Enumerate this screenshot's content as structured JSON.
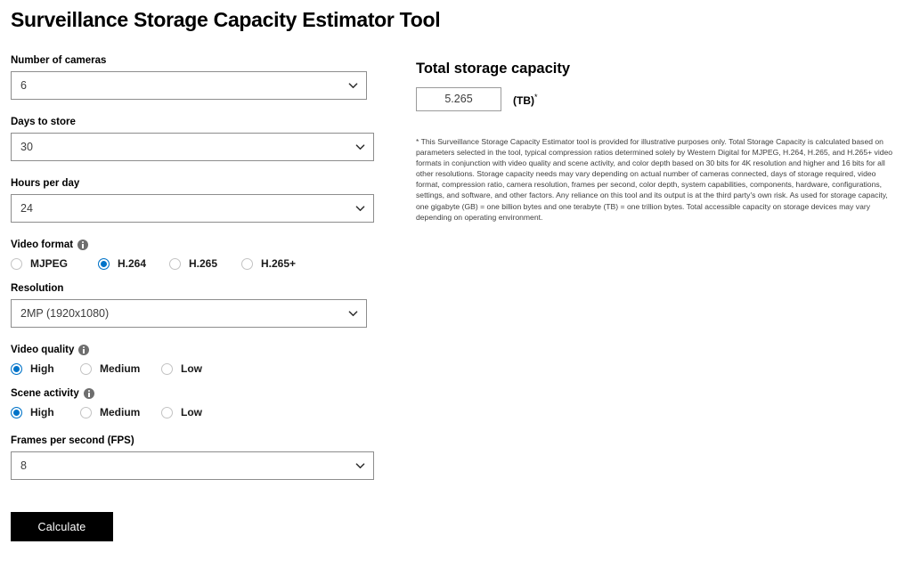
{
  "page": {
    "title": "Surveillance Storage Capacity Estimator Tool"
  },
  "form": {
    "cameras": {
      "label": "Number of cameras",
      "value": "6",
      "icon": "chevron-down-icon"
    },
    "days": {
      "label": "Days to store",
      "value": "30",
      "icon": "chevron-down-icon"
    },
    "hours": {
      "label": "Hours per day",
      "value": "24",
      "icon": "chevron-down-icon"
    },
    "video_format": {
      "label": "Video format",
      "info_icon": "info-icon",
      "options": [
        {
          "label": "MJPEG",
          "selected": false
        },
        {
          "label": "H.264",
          "selected": true
        },
        {
          "label": "H.265",
          "selected": false
        },
        {
          "label": "H.265+",
          "selected": false
        }
      ]
    },
    "resolution": {
      "label": "Resolution",
      "value": "2MP (1920x1080)",
      "icon": "chevron-down-icon"
    },
    "video_quality": {
      "label": "Video quality",
      "info_icon": "info-icon",
      "options": [
        {
          "label": "High",
          "selected": true
        },
        {
          "label": "Medium",
          "selected": false
        },
        {
          "label": "Low",
          "selected": false
        }
      ]
    },
    "scene_activity": {
      "label": "Scene activity",
      "info_icon": "info-icon",
      "options": [
        {
          "label": "High",
          "selected": true
        },
        {
          "label": "Medium",
          "selected": false
        },
        {
          "label": "Low",
          "selected": false
        }
      ]
    },
    "fps": {
      "label": "Frames per second (FPS)",
      "value": "8",
      "icon": "chevron-down-icon"
    },
    "calculate_label": "Calculate"
  },
  "result": {
    "title": "Total storage capacity",
    "value": "5.265",
    "unit": "(TB)",
    "unit_footnote": "*"
  },
  "disclaimer": {
    "text": "* This Surveillance Storage Capacity Estimator tool is provided for illustrative purposes only. Total Storage Capacity is calculated based on parameters selected in the tool, typical compression ratios determined solely by Western Digital for MJPEG, H.264, H.265, and H.265+ video formats in conjunction with video quality and scene activity, and color depth based on 30 bits for 4K resolution and higher and 16 bits for all other resolutions. Storage capacity needs may vary depending on actual number of cameras connected, days of storage required, video format, compression ratio, camera resolution, frames per second, color depth, system capabilities, components, hardware, configurations, settings, and software, and other factors. Any reliance on this tool and its output is at the third party's own risk. As used for storage capacity, one gigabyte (GB) = one billion bytes and one terabyte (TB) = one trillion bytes. Total accessible capacity on storage devices may vary depending on operating environment."
  },
  "colors": {
    "accent_blue": "#0073c8",
    "button_black": "#000000",
    "border_gray": "#8d8d8d",
    "info_gray": "#6e6e6e"
  }
}
